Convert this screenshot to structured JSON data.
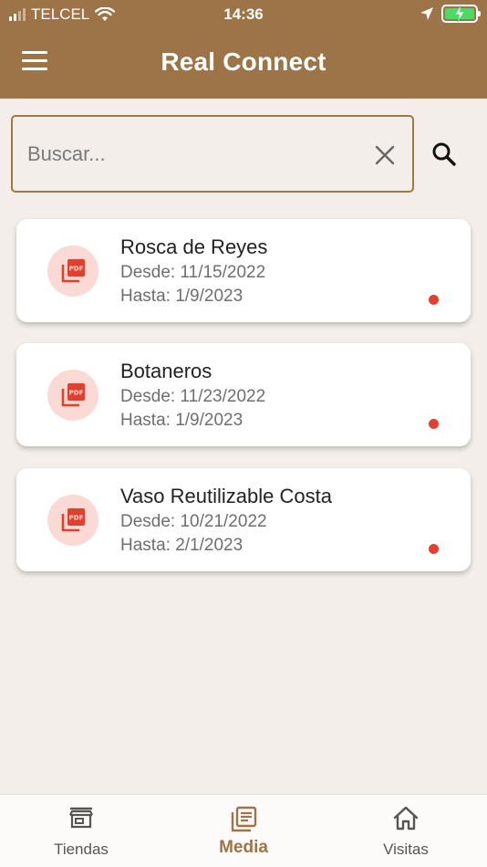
{
  "status_bar": {
    "carrier": "TELCEL",
    "time": "14:36"
  },
  "app_bar": {
    "title": "Real Connect",
    "background": "#9c7447"
  },
  "search": {
    "placeholder": "Buscar...",
    "value": ""
  },
  "media_items": [
    {
      "title": "Rosca de Reyes",
      "desde": "Desde: 11/15/2022",
      "hasta": "Hasta: 1/9/2023",
      "icon": "pdf-icon",
      "unread": true
    },
    {
      "title": "Botaneros",
      "desde": "Desde: 11/23/2022",
      "hasta": "Hasta: 1/9/2023",
      "icon": "pdf-icon",
      "unread": true
    },
    {
      "title": "Vaso Reutilizable Costa",
      "desde": "Desde: 10/21/2022",
      "hasta": "Hasta: 2/1/2023",
      "icon": "pdf-icon",
      "unread": true
    }
  ],
  "bottom_nav": {
    "items": [
      {
        "label": "Tiendas",
        "icon": "store-icon",
        "active": false
      },
      {
        "label": "Media",
        "icon": "media-icon",
        "active": true
      },
      {
        "label": "Visitas",
        "icon": "home-icon",
        "active": false
      }
    ]
  },
  "colors": {
    "accent": "#9c7447",
    "unread_dot": "#e0412e",
    "pdf_bg": "#fbd9d4",
    "pdf_fg": "#e0412e"
  }
}
